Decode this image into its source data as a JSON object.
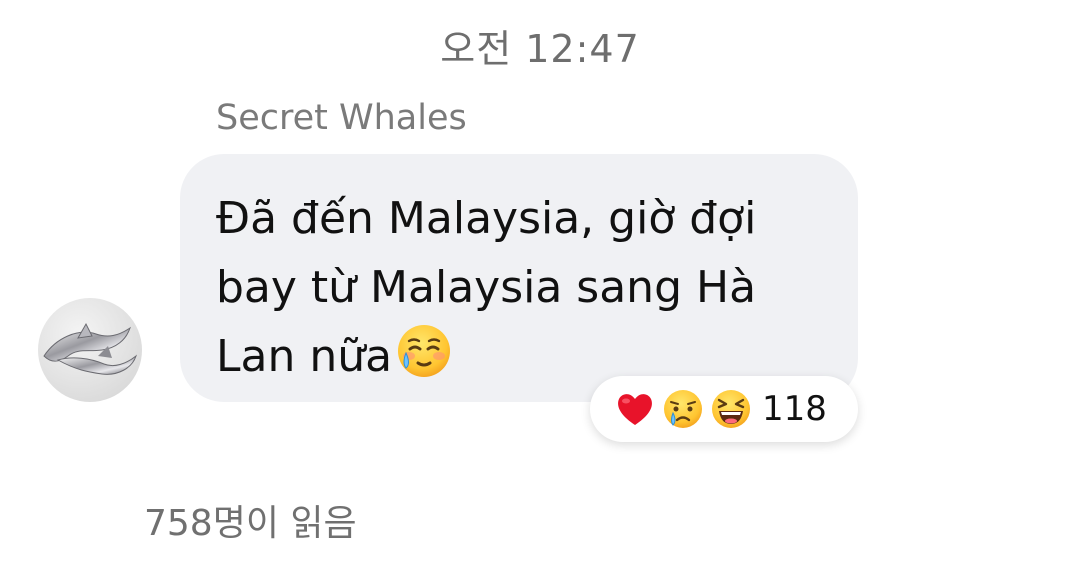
{
  "header": {
    "timestamp": "오전 12:47"
  },
  "message": {
    "sender_name": "Secret Whales",
    "line1": "Đã đến Malaysia, giờ đợi",
    "line2": "bay từ Malaysia sang Hà",
    "line3": "Lan nữa",
    "inline_emoji": "smiling-face-with-tear-icon",
    "bubble_color": "#f0f1f4"
  },
  "reactions": {
    "icons": [
      "heart-icon",
      "crying-face-icon",
      "laughing-face-icon"
    ],
    "count": "118"
  },
  "footer": {
    "read_count": "758명이 읽음"
  }
}
